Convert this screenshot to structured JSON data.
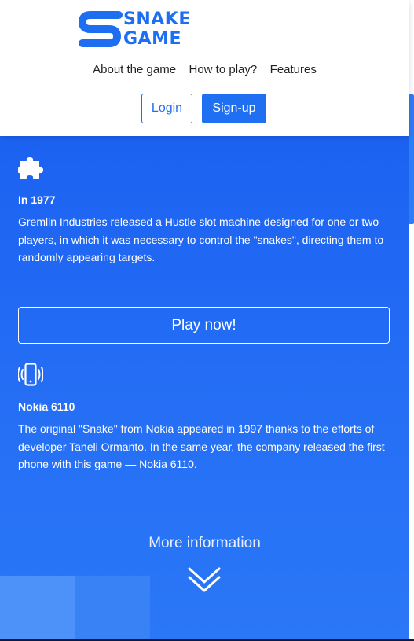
{
  "logo": {
    "word1": "SNAKE",
    "word2": "GAME",
    "icon": "snake-logo-icon"
  },
  "nav": {
    "items": [
      "About the game",
      "How to play?",
      "Features"
    ]
  },
  "auth": {
    "login": "Login",
    "signup": "Sign-up"
  },
  "features": [
    {
      "icon": "puzzle-icon",
      "title": "In 1977",
      "text": "Gremlin Industries released a Hustle slot machine designed for one or two players, in which it was necessary to control the \"snakes\", directing them to randomly appearing targets."
    },
    {
      "icon": "vibrating-phone-icon",
      "title": "Nokia 6110",
      "text": "The original \"Snake\" from Nokia appeared in 1997 thanks to the efforts of developer Taneli Ormanto. In the same year, the company released the first phone with this game — Nokia 6110."
    }
  ],
  "play_button": "Play now!",
  "more_info": "More information",
  "colors": {
    "brand": "#1e6ef2",
    "background_blue": "#2670f5",
    "white": "#ffffff"
  }
}
